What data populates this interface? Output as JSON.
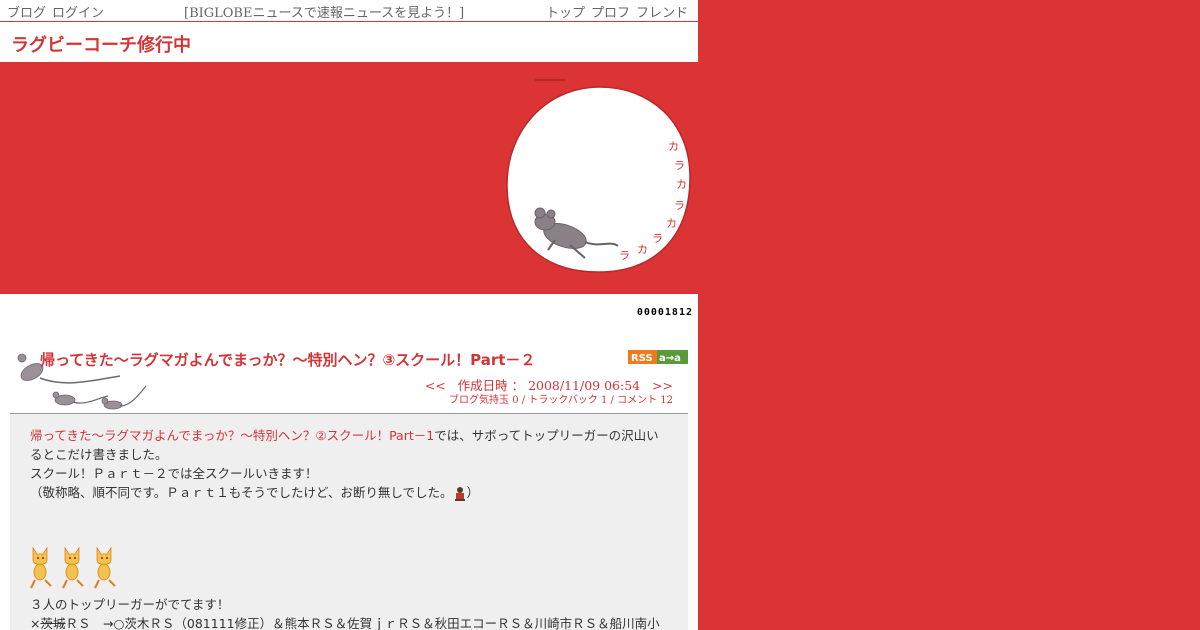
{
  "topbar": {
    "blog": "ブログ",
    "login": "ログイン",
    "news": "[BIGLOBEニュースで速報ニュースを見よう！]",
    "top": "トップ",
    "profile": "プロフ",
    "friend": "フレンド"
  },
  "blog_title": "ラグビーコーチ修行中",
  "banner_text": "ラカラカラカ",
  "counter": "00001812",
  "entry": {
    "title": "帰ってきた～ラグマガよんでまっか？～特別ヘン？③スクール！Part－２",
    "rss_label": "RSS",
    "rss_badge": "a→a",
    "nav_prev": "<<",
    "created_label": "作成日時 ：",
    "created_date": "2008/11/09 06:54",
    "nav_next": ">>",
    "stats": "ブログ気持玉 0 / トラックバック 1 / コメント 12"
  },
  "content": {
    "link_text": "帰ってきた～ラグマガよんでまっか？～特別ヘン？②スクール！Part－1",
    "line1_rest": "では、サボってトップリーガーの沢山いるとこだけ書きました。",
    "line2": "スクール！Ｐａｒｔ－２では全スクールいきます！",
    "line3_a": "（敬称略、順不同です。Ｐａｒｔ１もそうでしたけど、お断り無しでした。",
    "line3_b": "）",
    "line4": "３人のトップリーガーがでてます！",
    "line5_prefix": "×",
    "line5_strike": "茨城",
    "line5_rest": "ＲＳ　→○茨木ＲＳ（081111修正）＆熊本ＲＳ＆佐賀ｊｒＲＳ＆秋田エコーＲＳ＆川崎市ＲＳ＆船川南小"
  },
  "colors": {
    "accent": "#dc3334",
    "title_text": "#d43436",
    "content_bg": "#efefef"
  }
}
